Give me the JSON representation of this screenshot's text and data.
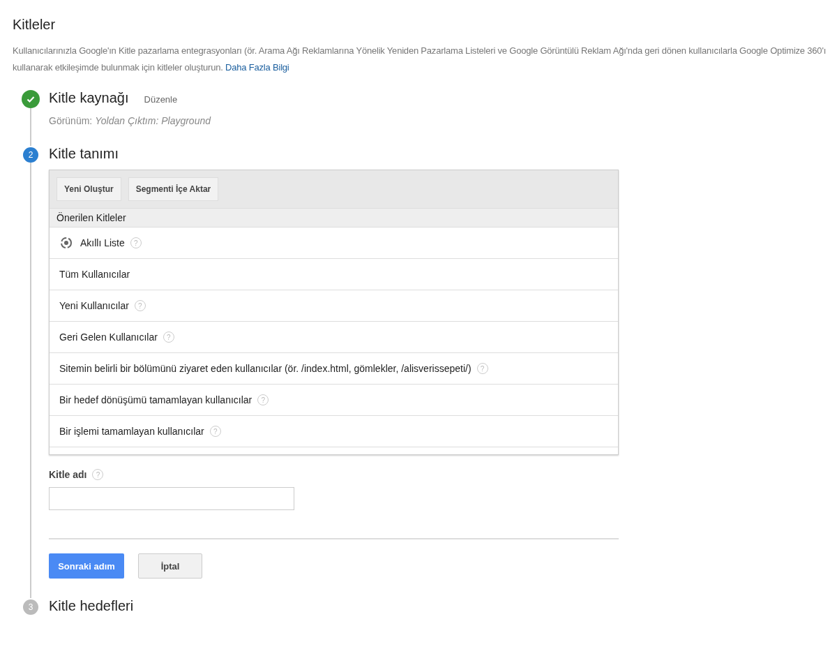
{
  "page": {
    "title": "Kitleler",
    "description": "Kullanıcılarınızla Google'ın Kitle pazarlama entegrasyonları (ör. Arama Ağı Reklamlarına Yönelik Yeniden Pazarlama Listeleri ve Google Görüntülü Reklam Ağı'nda geri dönen kullanıcılarla Google Optimize 360'ı kullanarak etkileşimde bulunmak için kitleler oluşturun.",
    "link": "Daha Fazla Bilgi"
  },
  "steps": [
    {
      "kind": "done",
      "title": "Kitle kaynağı",
      "edit": "Düzenle",
      "detail_label": "Görünüm:",
      "detail_value": "Yoldan Çıktım: Playground"
    },
    {
      "kind": "current",
      "number": "2",
      "title": "Kitle tanımı"
    },
    {
      "kind": "pending",
      "number": "3",
      "title": "Kitle hedefleri"
    }
  ],
  "definition": {
    "buttons": [
      "Yeni Oluştur",
      "Segmenti İçe Aktar"
    ],
    "section": "Önerilen Kitleler",
    "items": [
      {
        "kind": "smart",
        "label": "Akıllı Liste",
        "help": "?"
      },
      {
        "kind": "plain",
        "label": "Tüm Kullanıcılar"
      },
      {
        "kind": "plain",
        "label": "Yeni Kullanıcılar",
        "help": "?"
      },
      {
        "kind": "plain",
        "label": "Geri Gelen Kullanıcılar",
        "help": "?"
      },
      {
        "kind": "plain",
        "label": "Sitemin belirli bir bölümünü ziyaret eden kullanıcılar (ör. /index.html, gömlekler, /alisverissepeti/)",
        "help": "?"
      },
      {
        "kind": "plain",
        "label": "Bir hedef dönüşümü tamamlayan kullanıcılar",
        "help": "?"
      },
      {
        "kind": "plain",
        "label": "Bir işlemi tamamlayan kullanıcılar",
        "help": "?"
      }
    ],
    "name_label": "Kitle adı",
    "name_help": "?",
    "next": "Sonraki adım",
    "cancel": "İptal"
  }
}
